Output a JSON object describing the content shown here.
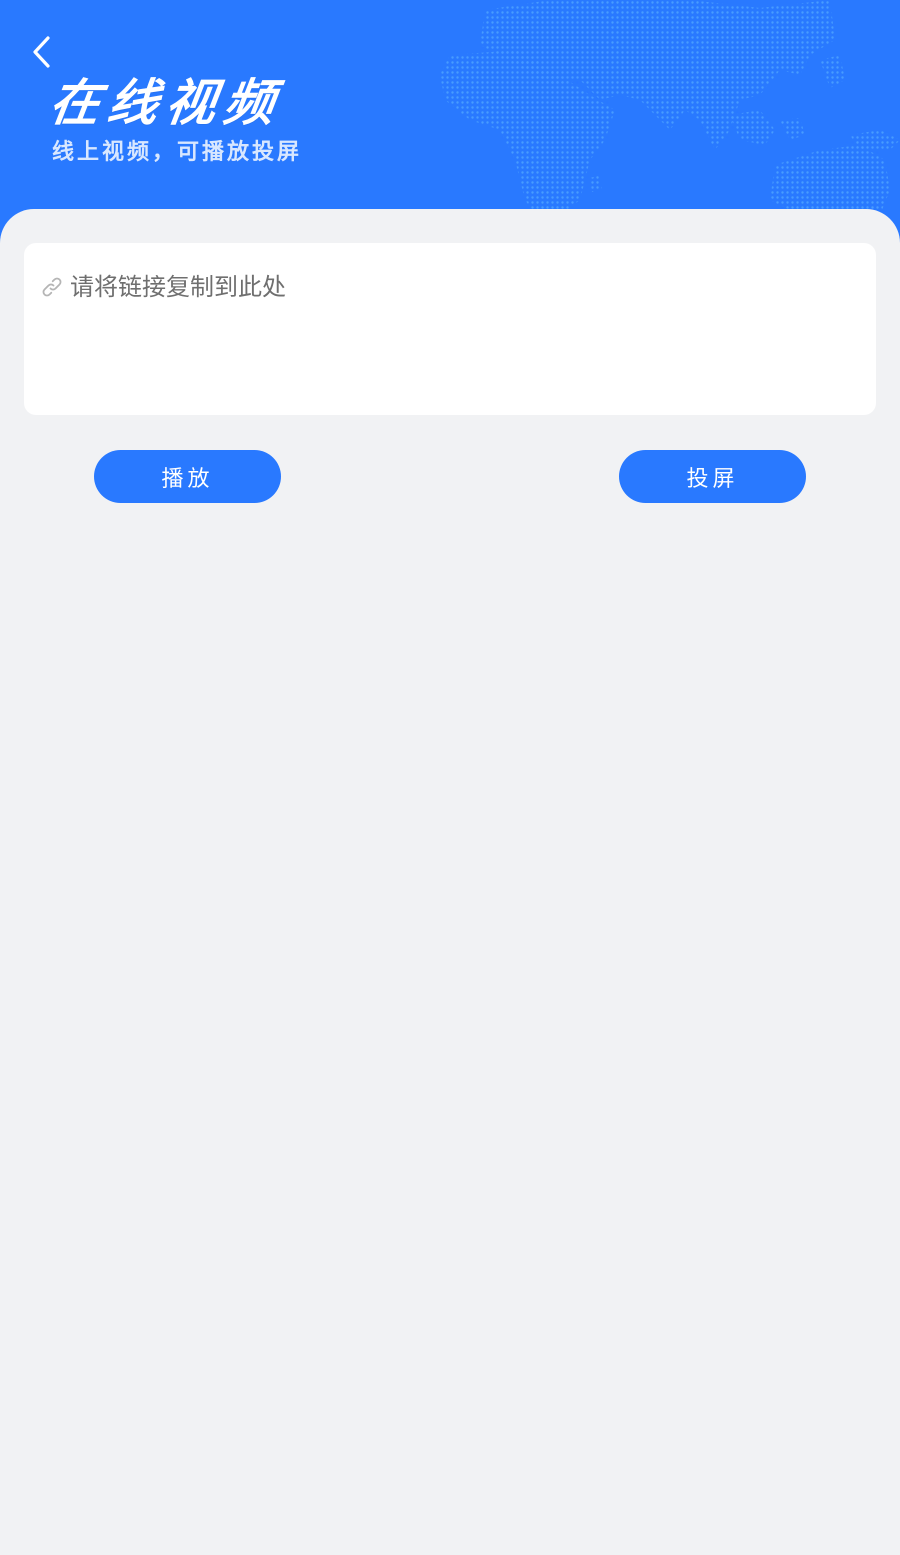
{
  "header": {
    "title": "在线视频",
    "subtitle": "线上视频，可播放投屏",
    "background_color": "#2979ff",
    "back_icon": "chevron-left-icon"
  },
  "url_input": {
    "value": "",
    "placeholder": "请将链接复制到此处",
    "icon": "link-icon"
  },
  "actions": {
    "play_label": "播放",
    "cast_label": "投屏",
    "button_color": "#2979ff"
  },
  "page_background": "#f1f2f4"
}
